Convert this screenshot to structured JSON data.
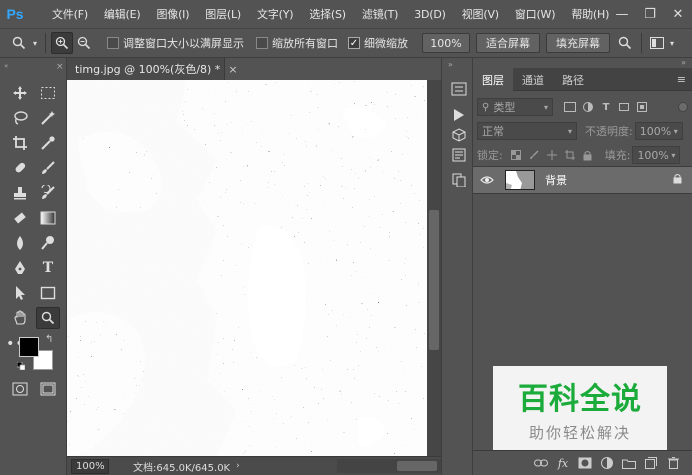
{
  "app": {
    "logo": "Ps",
    "accent": "#31a8ff"
  },
  "menu": [
    "文件(F)",
    "编辑(E)",
    "图像(I)",
    "图层(L)",
    "文字(Y)",
    "选择(S)",
    "滤镜(T)",
    "3D(D)",
    "视图(V)",
    "窗口(W)",
    "帮助(H)"
  ],
  "window_buttons": {
    "minimize": "—",
    "maximize": "❐",
    "close": "✕"
  },
  "options": {
    "resize_windows": "调整窗口大小以满屏显示",
    "zoom_all": "缩放所有窗口",
    "scrubby_zoom": "细微缩放",
    "scrubby_checked": true,
    "zoom_100": "100%",
    "fit_screen": "适合屏幕",
    "fill_screen": "填充屏幕"
  },
  "document": {
    "tab_title": "timg.jpg @ 100%(灰色/8) *",
    "close": "×",
    "zoom": "100%",
    "doc_size": "文档:645.0K/645.0K"
  },
  "layers_panel": {
    "tabs": [
      "图层",
      "通道",
      "路径"
    ],
    "kind_filter": "类型",
    "blend_mode": "正常",
    "opacity_label": "不透明度:",
    "opacity": "100%",
    "lock_label": "锁定:",
    "fill_label": "填充:",
    "fill": "100%",
    "layer_name": "背景",
    "bottom_icons": [
      "link-icon",
      "fx-icon",
      "mask-icon",
      "adjustment-icon",
      "group-icon",
      "new-layer-icon",
      "trash-icon"
    ]
  },
  "watermark": {
    "title": "百科全说",
    "subtitle": "助你轻松解决",
    "color": "#1aab3a"
  }
}
